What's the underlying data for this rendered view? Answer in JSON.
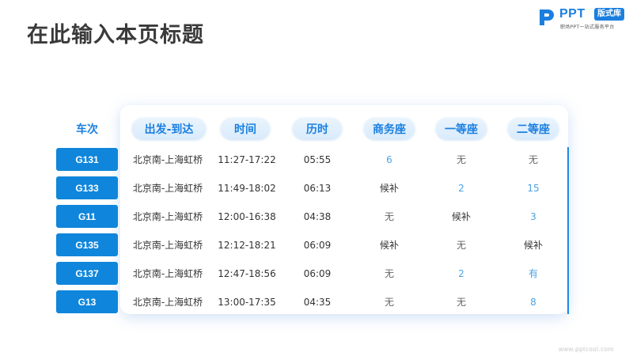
{
  "page": {
    "title": "在此输入本页标题"
  },
  "logo": {
    "text": "PPT",
    "badge": "版式库",
    "tagline": "职场PPT一站式服务平台"
  },
  "table": {
    "headers": [
      "车次",
      "出发-到达",
      "时间",
      "历时",
      "商务座",
      "一等座",
      "二等座"
    ],
    "rows": [
      {
        "train": "G131",
        "route": "北京南-上海虹桥",
        "time": "11:27-17:22",
        "duration": "05:55",
        "business": "6",
        "first": "无",
        "second": "无"
      },
      {
        "train": "G133",
        "route": "北京南-上海虹桥",
        "time": "11:49-18:02",
        "duration": "06:13",
        "business": "候补",
        "first": "2",
        "second": "15"
      },
      {
        "train": "G11",
        "route": "北京南-上海虹桥",
        "time": "12:00-16:38",
        "duration": "04:38",
        "business": "无",
        "first": "候补",
        "second": "3"
      },
      {
        "train": "G135",
        "route": "北京南-上海虹桥",
        "time": "12:12-18:21",
        "duration": "06:09",
        "business": "候补",
        "first": "无",
        "second": "候补"
      },
      {
        "train": "G137",
        "route": "北京南-上海虹桥",
        "time": "12:47-18:56",
        "duration": "06:09",
        "business": "无",
        "first": "2",
        "second": "有"
      },
      {
        "train": "G13",
        "route": "北京南-上海虹桥",
        "time": "13:00-17:35",
        "duration": "04:35",
        "business": "无",
        "first": "无",
        "second": "8"
      }
    ]
  },
  "watermark": "www.pptcool.com",
  "colors": {
    "accent": "#1b7fe0",
    "badge": "#0f86db",
    "available": "#4aa3e6"
  }
}
